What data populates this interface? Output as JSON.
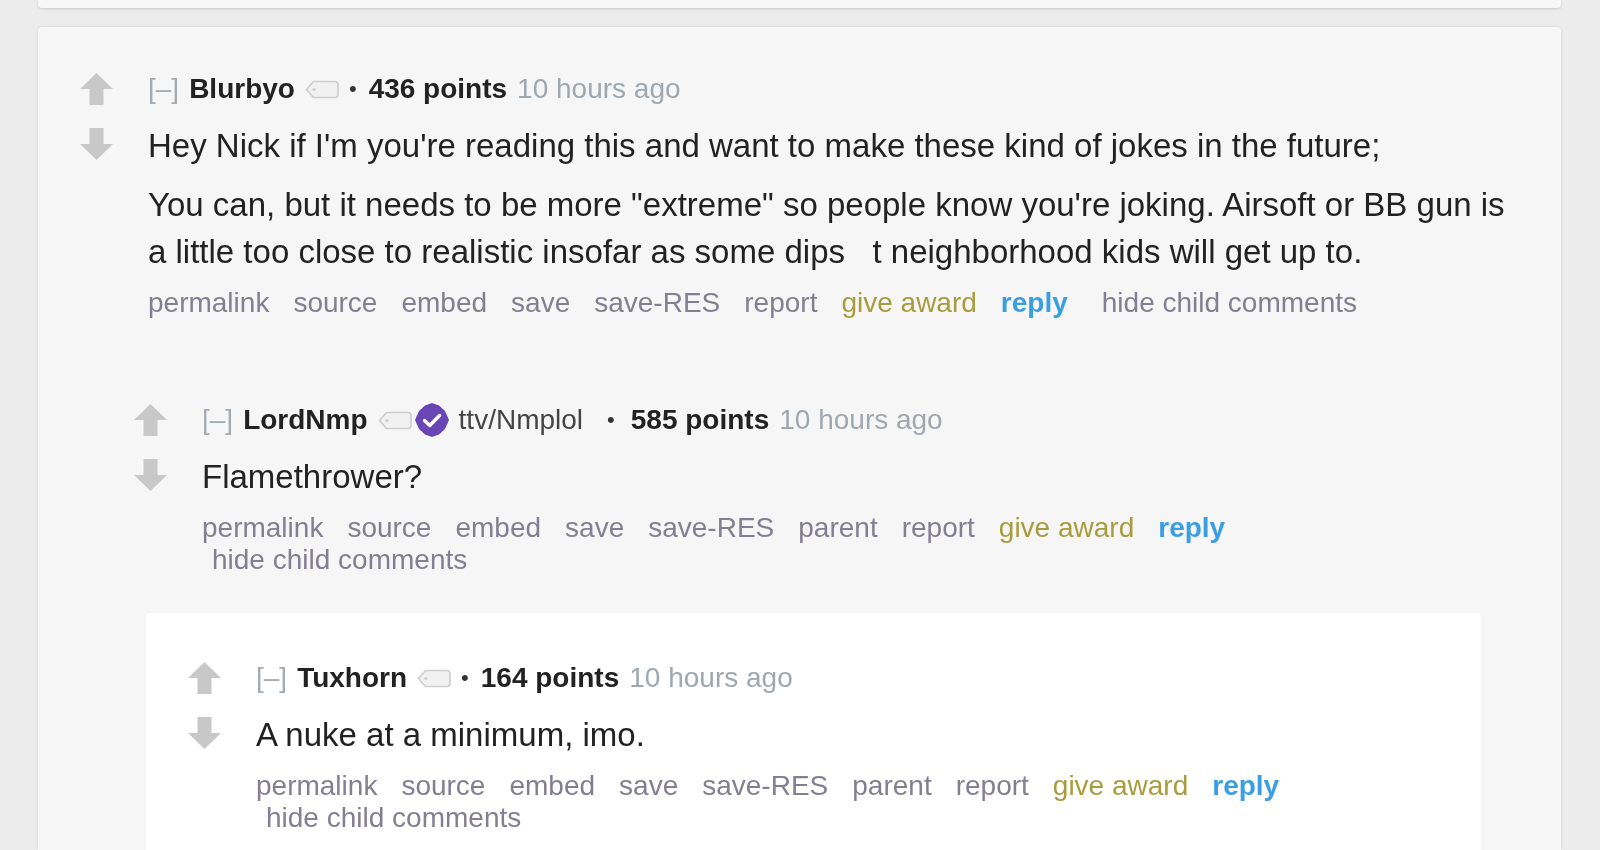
{
  "comments": [
    {
      "collapse_toggle": "[–]",
      "author": "Blurbyo",
      "verified": false,
      "separator": "•",
      "points": "436 points",
      "time": "10 hours ago",
      "paragraphs": [
        "Hey Nick if I'm you're reading this and want to make these kind of jokes in the future;",
        "You can, but it needs to be more \"extreme\" so people know you're joking. Airsoft or BB gun is a little too close to realistic insofar as some dips   t neighborhood kids will get up to."
      ],
      "actions": [
        {
          "label": "permalink",
          "kind": "link"
        },
        {
          "label": "source",
          "kind": "link"
        },
        {
          "label": "embed",
          "kind": "link"
        },
        {
          "label": "save",
          "kind": "link"
        },
        {
          "label": "save-RES",
          "kind": "link"
        },
        {
          "label": "report",
          "kind": "link"
        },
        {
          "label": "give award",
          "kind": "award"
        },
        {
          "label": "reply",
          "kind": "reply"
        },
        {
          "label": "hide child comments",
          "kind": "hide"
        }
      ],
      "children": [
        {
          "collapse_toggle": "[–]",
          "author": "LordNmp",
          "verified": true,
          "flair": "ttv/Nmplol",
          "separator": "•",
          "points": "585 points",
          "time": "10 hours ago",
          "paragraphs": [
            "Flamethrower?"
          ],
          "actions": [
            {
              "label": "permalink",
              "kind": "link"
            },
            {
              "label": "source",
              "kind": "link"
            },
            {
              "label": "embed",
              "kind": "link"
            },
            {
              "label": "save",
              "kind": "link"
            },
            {
              "label": "save-RES",
              "kind": "link"
            },
            {
              "label": "parent",
              "kind": "link"
            },
            {
              "label": "report",
              "kind": "link"
            },
            {
              "label": "give award",
              "kind": "award"
            },
            {
              "label": "reply",
              "kind": "reply"
            },
            {
              "label": "hide child comments",
              "kind": "hide"
            }
          ],
          "children": [
            {
              "collapse_toggle": "[–]",
              "author": "Tuxhorn",
              "verified": false,
              "separator": "•",
              "points": "164 points",
              "time": "10 hours ago",
              "paragraphs": [
                "A nuke at a minimum, imo."
              ],
              "actions": [
                {
                  "label": "permalink",
                  "kind": "link"
                },
                {
                  "label": "source",
                  "kind": "link"
                },
                {
                  "label": "embed",
                  "kind": "link"
                },
                {
                  "label": "save",
                  "kind": "link"
                },
                {
                  "label": "save-RES",
                  "kind": "link"
                },
                {
                  "label": "parent",
                  "kind": "link"
                },
                {
                  "label": "report",
                  "kind": "link"
                },
                {
                  "label": "give award",
                  "kind": "award"
                },
                {
                  "label": "reply",
                  "kind": "reply"
                },
                {
                  "label": "hide child comments",
                  "kind": "hide"
                }
              ]
            }
          ]
        }
      ]
    }
  ]
}
